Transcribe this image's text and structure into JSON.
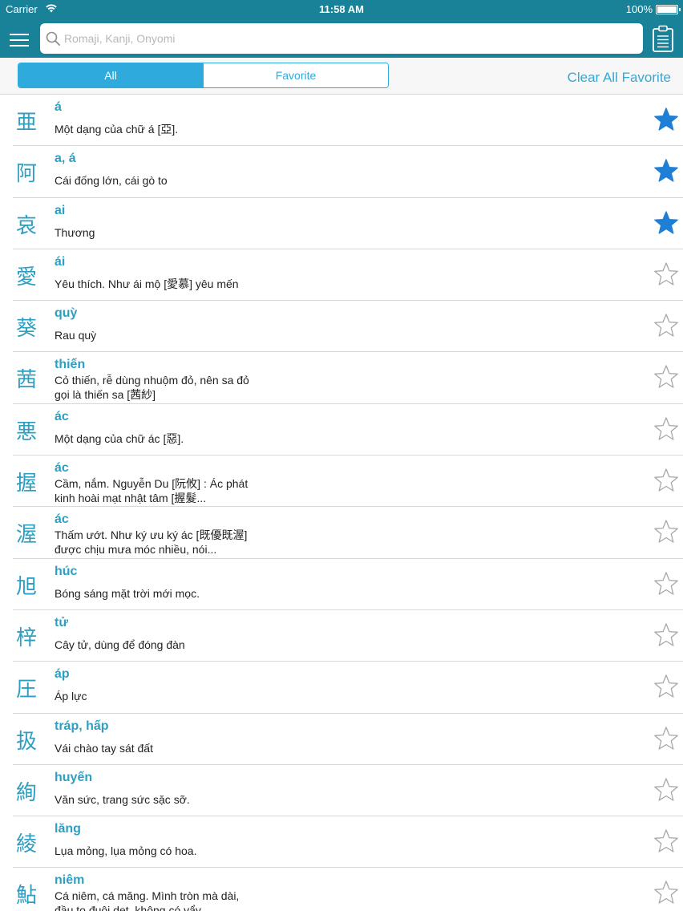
{
  "status_bar": {
    "carrier": "Carrier",
    "time": "11:58 AM",
    "battery": "100%"
  },
  "search": {
    "placeholder": "Romaji, Kanji, Onyomi",
    "value": ""
  },
  "tabs": {
    "all": "All",
    "favorite": "Favorite",
    "active": "all"
  },
  "clear_all_favorite": "Clear All Favorite",
  "colors": {
    "header": "#1a8298",
    "accent": "#2eaadc",
    "kanji": "#2e9fc2",
    "star_filled": "#1f7ed6",
    "star_empty": "#a6a6a6"
  },
  "entries": [
    {
      "kanji": "亜",
      "reading": "á",
      "meaning": "Một dạng của chữ á [亞].",
      "favorite": true
    },
    {
      "kanji": "阿",
      "reading": "a, á",
      "meaning": "Cái đống lớn, cái gò to",
      "favorite": true
    },
    {
      "kanji": "哀",
      "reading": "ai",
      "meaning": "Thương",
      "favorite": true
    },
    {
      "kanji": "愛",
      "reading": "ái",
      "meaning": "Yêu thích. Như ái mộ [愛慕] yêu mến",
      "favorite": false
    },
    {
      "kanji": "葵",
      "reading": "quỳ",
      "meaning": "Rau quỳ",
      "favorite": false
    },
    {
      "kanji": "茜",
      "reading": "thiến",
      "meaning": "Cỏ thiến, rễ dùng nhuộm đỏ, nên sa đỏ gọi là thiến sa [茜紗]",
      "favorite": false
    },
    {
      "kanji": "悪",
      "reading": "ác",
      "meaning": "Một dạng của chữ ác [惡].",
      "favorite": false
    },
    {
      "kanji": "握",
      "reading": "ác",
      "meaning": "Cầm, nắm. Nguyễn Du [阮攸] : Ác phát kinh hoài mạt nhật tâm [握髮...",
      "favorite": false
    },
    {
      "kanji": "渥",
      "reading": "ác",
      "meaning": "Thấm ướt. Như ký ưu ký ác [既優既渥] được chịu mưa móc nhiều, nói...",
      "favorite": false
    },
    {
      "kanji": "旭",
      "reading": "húc",
      "meaning": "Bóng sáng mặt trời mới mọc.",
      "favorite": false
    },
    {
      "kanji": "梓",
      "reading": "tử",
      "meaning": "Cây tử, dùng để đóng đàn",
      "favorite": false
    },
    {
      "kanji": "圧",
      "reading": "áp",
      "meaning": "Áp lực",
      "favorite": false
    },
    {
      "kanji": "扱",
      "reading": "tráp, hấp",
      "meaning": "Vái chào tay sát đất",
      "favorite": false
    },
    {
      "kanji": "絢",
      "reading": "huyến",
      "meaning": "Văn sức, trang sức sặc sỡ.",
      "favorite": false
    },
    {
      "kanji": "綾",
      "reading": "lăng",
      "meaning": "Lụa mỏng, lụa mỏng có hoa.",
      "favorite": false
    },
    {
      "kanji": "鮎",
      "reading": "niêm",
      "meaning": "Cá niêm, cá măng. Mình tròn mà dài, đầu to đuôi dẹt, không có vẩy...",
      "favorite": false
    }
  ]
}
